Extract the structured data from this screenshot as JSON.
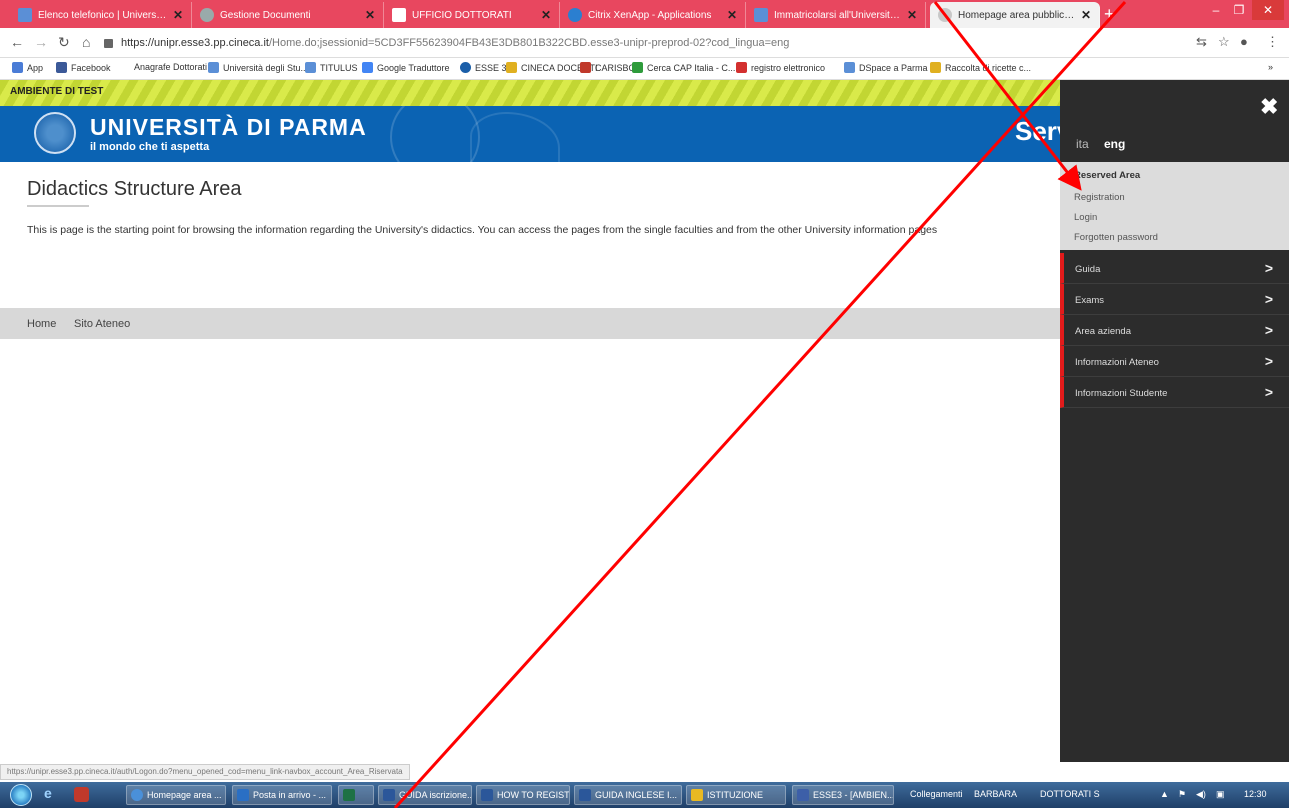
{
  "browser": {
    "tabs": [
      {
        "title": "Elenco telefonico | Università deg"
      },
      {
        "title": "Gestione Documenti"
      },
      {
        "title": "UFFICIO DOTTORATI"
      },
      {
        "title": "Citrix XenApp - Applications"
      },
      {
        "title": "Immatricolarsi all'Università di Pa"
      },
      {
        "title": "Homepage area pubblica, Univer"
      }
    ],
    "url_domain": "https://unipr.esse3.pp.cineca.it",
    "url_path": "/Home.do;jsessionid=5CD3FF55623904FB43E3DB801B322CBD.esse3-unipr-preprod-02?cod_lingua=eng",
    "bookmarks": [
      "App",
      "Facebook",
      "Anagrafe Dottorati",
      "Università degli Stu...",
      "TITULUS",
      "Google Traduttore",
      "ESSE 3",
      "CINECA DOCENTI",
      "CARISBO",
      "Cerca CAP Italia - C...",
      "registro elettronico",
      "DSpace a Parma",
      "Raccolta di ricette c..."
    ],
    "bookmarks_more": "»"
  },
  "site": {
    "test_banner": "AMBIENTE DI TEST",
    "uni_name": "UNIVERSITÀ DI PARMA",
    "uni_tagline": "il mondo che ti aspetta",
    "header_partial": "Serv"
  },
  "main": {
    "title": "Didactics Structure Area",
    "intro": "This is page is the starting point for browsing the information regarding the University's didactics. You can access the pages from the single faculties and from the other University information pages",
    "footer_links": [
      "Home",
      "Sito Ateneo"
    ]
  },
  "sidepanel": {
    "close": "✖",
    "lang_ita": "ita",
    "lang_eng": "eng",
    "reserved_title": "Reserved Area",
    "reserved_links": [
      "Registration",
      "Login",
      "Forgotten password"
    ],
    "menu": [
      "Guida",
      "Exams",
      "Area azienda",
      "Informazioni Ateneo",
      "Informazioni Studente"
    ],
    "chevron": ">"
  },
  "status_url": "https://unipr.esse3.pp.cineca.it/auth/Logon.do?menu_opened_cod=menu_link-navbox_account_Area_Riservata",
  "taskbar": {
    "buttons": [
      "Homepage area ...",
      "Posta in arrivo - ...",
      "",
      "GUIDA iscrizione...",
      "HOW TO REGIST...",
      "GUIDA INGLESE I...",
      "ISTITUZIONE",
      "ESSE3 - [AMBIEN..."
    ],
    "tray_text": [
      "Collegamenti",
      "BARBARA",
      "DOTTORATI S"
    ],
    "clock": "12:30"
  },
  "colors": {
    "tab_strip": "#e8475f",
    "uni_blue": "#0b63b3",
    "test_green": "#c2d633",
    "panel_dark": "#2c2c2c",
    "accent_red": "#e21b1b"
  }
}
